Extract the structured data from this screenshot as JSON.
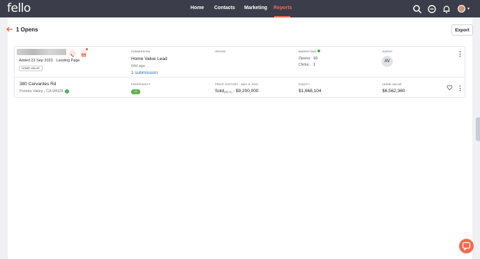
{
  "nav": {
    "logo": "fello",
    "links": [
      "Home",
      "Contacts",
      "Marketing",
      "Reports"
    ],
    "active": "Reports",
    "accent_color": "#f26b4d",
    "icons": [
      "search-icon",
      "add-circle-icon",
      "bell-icon",
      "user-avatar"
    ]
  },
  "page": {
    "title": "1 Opens",
    "export_label": "Export"
  },
  "contact": {
    "added_text": "Added 23 Sep 2023 · Landing Page",
    "tag": "HOME VALUE",
    "submission_label": "SUBMISSION",
    "submission_title": "Home Value Lead",
    "submission_age": "64d ago",
    "submission_link": "1 submission",
    "origin_label": "ORIGIN",
    "marketing_label": "MARKETING",
    "opens_label": "Opens:",
    "opens_value": "10",
    "clicks_label": "Clicks:",
    "clicks_value": "1",
    "agent_label": "AGENT",
    "agent_initials": "AV"
  },
  "property": {
    "address": "380 Cervantes Rd",
    "city": "Portola Valley , CA 94028",
    "propensity_label": "PROPENSITY",
    "propensity_value": "77",
    "price_history_label": "PRICE HISTORY · MAY 5, 2022",
    "sold_label": "Sold",
    "sold_source": "(MLS)",
    "sold_value": "· $9,200,000",
    "equity_label": "EQUITY",
    "equity_value": "$1,668,104",
    "home_value_label": "HOME VALUE",
    "home_value_value": "$6,562,360"
  }
}
